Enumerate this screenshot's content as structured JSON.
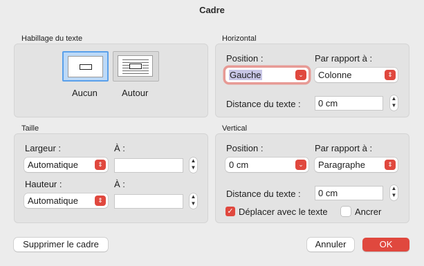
{
  "dialog": {
    "title": "Cadre"
  },
  "wrap": {
    "title": "Habillage du texte",
    "options": [
      {
        "label": "Aucun",
        "selected": true
      },
      {
        "label": "Autour",
        "selected": false
      }
    ]
  },
  "horizontal": {
    "title": "Horizontal",
    "position_label": "Position :",
    "position_value": "Gauche",
    "relative_label": "Par rapport à :",
    "relative_value": "Colonne",
    "distance_label": "Distance du texte :",
    "distance_value": "0 cm"
  },
  "size": {
    "title": "Taille",
    "width_label": "Largeur :",
    "width_value": "Automatique",
    "width_at_label": "À :",
    "width_at_value": "",
    "height_label": "Hauteur :",
    "height_value": "Automatique",
    "height_at_label": "À :",
    "height_at_value": ""
  },
  "vertical": {
    "title": "Vertical",
    "position_label": "Position :",
    "position_value": "0 cm",
    "relative_label": "Par rapport à :",
    "relative_value": "Paragraphe",
    "distance_label": "Distance du texte :",
    "distance_value": "0 cm",
    "move_with_text_label": "Déplacer avec le texte",
    "move_with_text_checked": true,
    "anchor_label": "Ancrer",
    "anchor_checked": false
  },
  "buttons": {
    "remove_frame": "Supprimer le cadre",
    "cancel": "Annuler",
    "ok": "OK"
  },
  "colors": {
    "accent": "#e0483e",
    "selection": "#5aa0ea"
  },
  "icons": {
    "popup_arrow": "chevron-up-down-icon",
    "stepper": "stepper-arrows-icon",
    "check": "checkmark-icon"
  }
}
